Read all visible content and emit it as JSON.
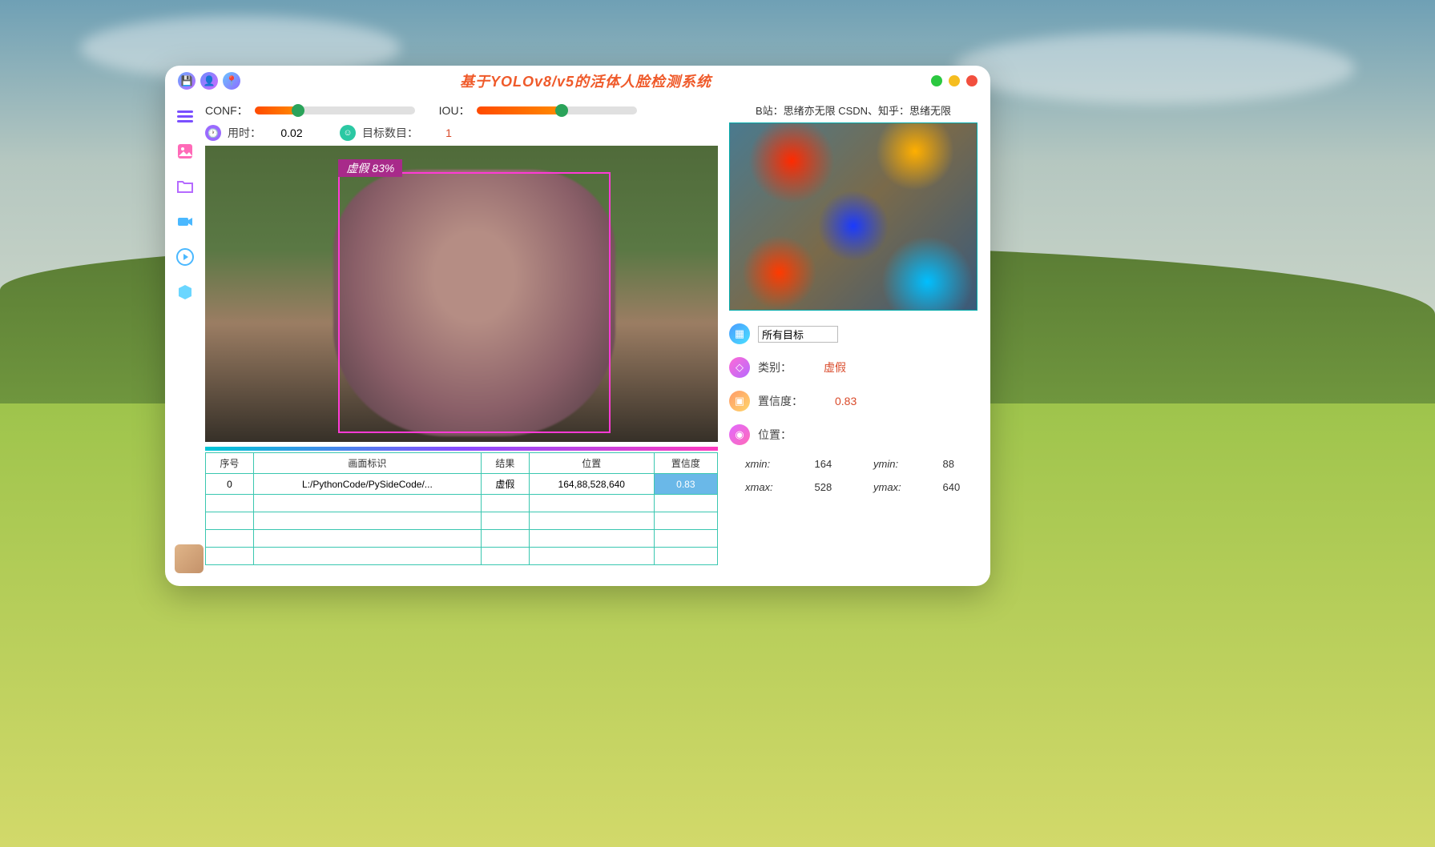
{
  "title": "基于YOLOv8/v5的活体人脸检测系统",
  "controls": {
    "conf_label": "CONF：",
    "conf_pct": 27,
    "iou_label": "IOU：",
    "iou_pct": 53,
    "time_label": "用时：",
    "time_value": "0.02",
    "targets_label": "目标数目：",
    "targets_value": "1"
  },
  "credit": "B站：思绪亦无限  CSDN、知乎：思绪无限",
  "bbox_label": "虚假  83%",
  "table": {
    "headers": {
      "idx": "序号",
      "img": "画面标识",
      "res": "结果",
      "pos": "位置",
      "conf": "置信度"
    },
    "row": {
      "idx": "0",
      "img": "L:/PythonCode/PySideCode/...",
      "res": "虚假",
      "pos": "164,88,528,640",
      "conf": "0.83"
    }
  },
  "panel": {
    "targets_input": "所有目标",
    "class_label": "类别：",
    "class_value": "虚假",
    "conf_label": "置信度：",
    "conf_value": "0.83",
    "pos_label": "位置：",
    "coords": {
      "xmin_k": "xmin:",
      "xmin_v": "164",
      "ymin_k": "ymin:",
      "ymin_v": "88",
      "xmax_k": "xmax:",
      "xmax_v": "528",
      "ymax_k": "ymax:",
      "ymax_v": "640"
    }
  }
}
